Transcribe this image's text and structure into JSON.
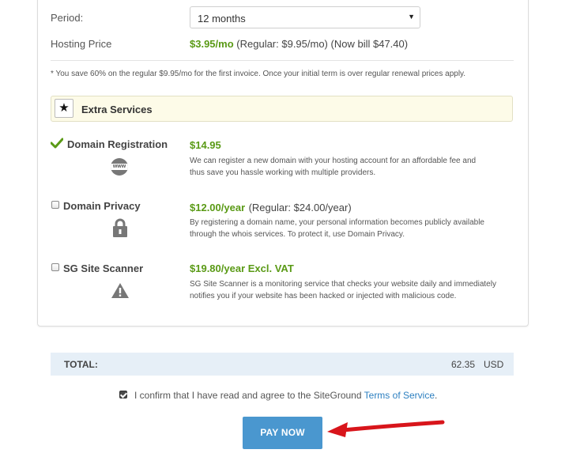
{
  "period": {
    "label": "Period:",
    "value": "12 months",
    "arrow": "▼"
  },
  "hosting_price": {
    "label": "Hosting Price",
    "price": "$3.95/mo",
    "regular": "(Regular: $9.95/mo)",
    "now_bill": "(Now bill $47.40)"
  },
  "savings_note": "* You save 60% on the regular $9.95/mo for the first invoice. Once your initial term is over regular renewal prices apply.",
  "extras": {
    "title": "Extra Services",
    "icon": "★",
    "services": [
      {
        "name": "Domain Registration",
        "price": "$14.95",
        "regular": "",
        "description_1": "We can register a new domain with your hosting account for an affordable fee and",
        "description_2": "thus save you hassle working with multiple providers.",
        "icon_text": "www",
        "selected": true
      },
      {
        "name": "Domain Privacy",
        "price": "$12.00/year",
        "regular": "(Regular: $24.00/year)",
        "description_1": "By registering a domain name, your personal information becomes publicly available",
        "description_2": "through the whois services. To protect it, use Domain Privacy.",
        "selected": false
      },
      {
        "name": "SG Site Scanner",
        "price": "$19.80/year Excl. VAT",
        "regular": "",
        "description_1": "SG Site Scanner is a monitoring service that checks your website daily and immediately",
        "description_2": "notifies you if your website has been hacked or injected with malicious code.",
        "selected": false
      }
    ]
  },
  "total": {
    "label": "TOTAL:",
    "amount": "62.35",
    "currency": "USD"
  },
  "terms": {
    "text": "I confirm that I have read and agree to the SiteGround",
    "link": "Terms of Service",
    "period": ".",
    "checked": true
  },
  "pay_button": "PAY NOW",
  "colors": {
    "accent_green": "#5a9a16",
    "button_blue": "#4a97cf",
    "total_bg": "#e6eff7",
    "arrow_red": "#d8151b"
  }
}
